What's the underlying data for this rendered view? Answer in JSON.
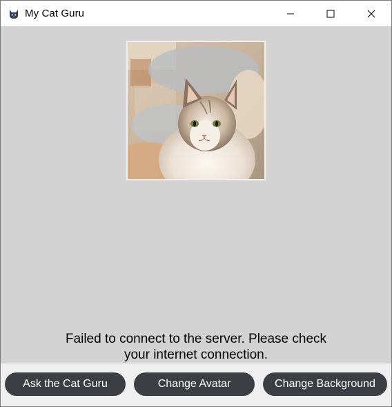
{
  "window": {
    "title": "My Cat Guru",
    "app_icon": "cat-icon"
  },
  "titlebar_controls": {
    "minimize_icon": "minimize-icon",
    "maximize_icon": "maximize-icon",
    "close_icon": "close-icon"
  },
  "avatar": {
    "description_icon": "cat-avatar-image"
  },
  "status": {
    "line1": "Failed to connect to the server. Please check",
    "line2": "your internet connection."
  },
  "actions": {
    "ask_label": "Ask the Cat Guru",
    "change_avatar_label": "Change Avatar",
    "change_background_label": "Change Background"
  },
  "colors": {
    "content_bg": "#d3d3d3",
    "button_bg": "#3b3f43",
    "button_text": "#ffffff",
    "bottombar_bg": "#efefef"
  }
}
